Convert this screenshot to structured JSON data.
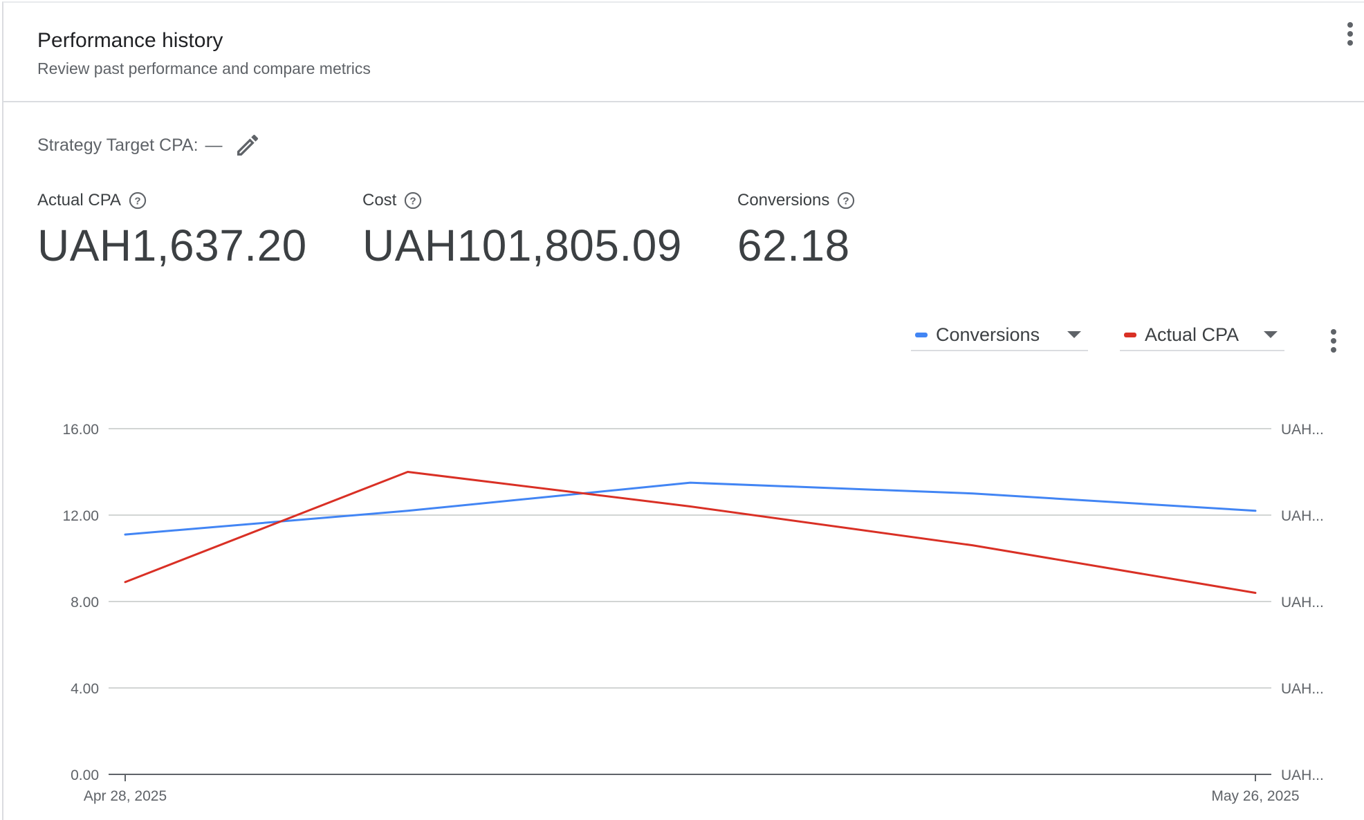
{
  "header": {
    "title": "Performance history",
    "subtitle": "Review past performance and compare metrics"
  },
  "strategy": {
    "label": "Strategy Target CPA:",
    "value": "—"
  },
  "metrics": [
    {
      "label": "Actual CPA",
      "value": "UAH1,637.20"
    },
    {
      "label": "Cost",
      "value": "UAH101,805.09"
    },
    {
      "label": "Conversions",
      "value": "62.18"
    }
  ],
  "selectors": {
    "left": {
      "label": "Conversions",
      "color": "#4285f4"
    },
    "right": {
      "label": "Actual CPA",
      "color": "#d93025"
    }
  },
  "icons": [
    "more-vert-icon",
    "pencil-icon",
    "help-circle-icon",
    "dropdown-caret-icon"
  ],
  "chart_data": {
    "type": "line",
    "x": [
      "Apr 28, 2025",
      "",
      "",
      "",
      "May 26, 2025"
    ],
    "x_tick_labels": [
      "Apr 28, 2025",
      "May 26, 2025"
    ],
    "ylim": [
      0,
      16
    ],
    "y_ticks": [
      "0.00",
      "4.00",
      "8.00",
      "12.00",
      "16.00"
    ],
    "y2_ticks": [
      "UAH...",
      "UAH...",
      "UAH...",
      "UAH...",
      "UAH..."
    ],
    "grid": true,
    "series": [
      {
        "name": "Conversions",
        "axis": "left",
        "color": "#4285f4",
        "values": [
          11.1,
          12.2,
          13.5,
          13.0,
          12.2
        ]
      },
      {
        "name": "Actual CPA",
        "axis": "right",
        "color": "#d93025",
        "values": [
          8.9,
          14.0,
          12.4,
          10.6,
          8.4
        ]
      }
    ]
  }
}
